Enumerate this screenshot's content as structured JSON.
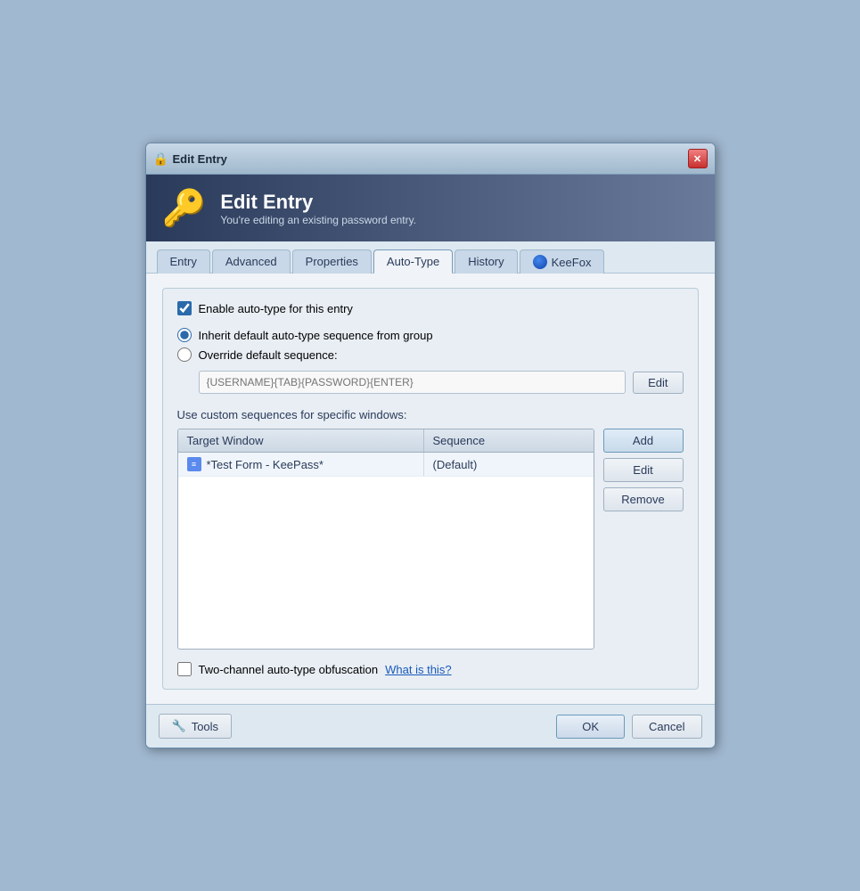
{
  "window": {
    "title": "Edit Entry"
  },
  "header": {
    "title": "Edit Entry",
    "subtitle": "You're editing an existing password entry."
  },
  "tabs": [
    {
      "id": "entry",
      "label": "Entry",
      "active": false
    },
    {
      "id": "advanced",
      "label": "Advanced",
      "active": false
    },
    {
      "id": "properties",
      "label": "Properties",
      "active": false
    },
    {
      "id": "auto-type",
      "label": "Auto-Type",
      "active": true
    },
    {
      "id": "history",
      "label": "History",
      "active": false
    },
    {
      "id": "keefox",
      "label": "KeeFox",
      "active": false
    }
  ],
  "content": {
    "enable_autotype_label": "Enable auto-type for this entry",
    "inherit_radio_label": "Inherit default auto-type sequence from group",
    "override_radio_label": "Override default sequence:",
    "override_placeholder": "{USERNAME}{TAB}{PASSWORD}{ENTER}",
    "override_edit_btn": "Edit",
    "custom_seq_label": "Use custom sequences for specific windows:",
    "table": {
      "columns": [
        "Target Window",
        "Sequence"
      ],
      "rows": [
        {
          "icon": "list",
          "window": "*Test Form - KeePass*",
          "sequence": "(Default)"
        }
      ]
    },
    "add_btn": "Add",
    "edit_btn": "Edit",
    "remove_btn": "Remove",
    "obfuscation_label": "Two-channel auto-type obfuscation",
    "what_is_this": "What is this?"
  },
  "footer": {
    "tools_btn": "Tools",
    "ok_btn": "OK",
    "cancel_btn": "Cancel"
  }
}
